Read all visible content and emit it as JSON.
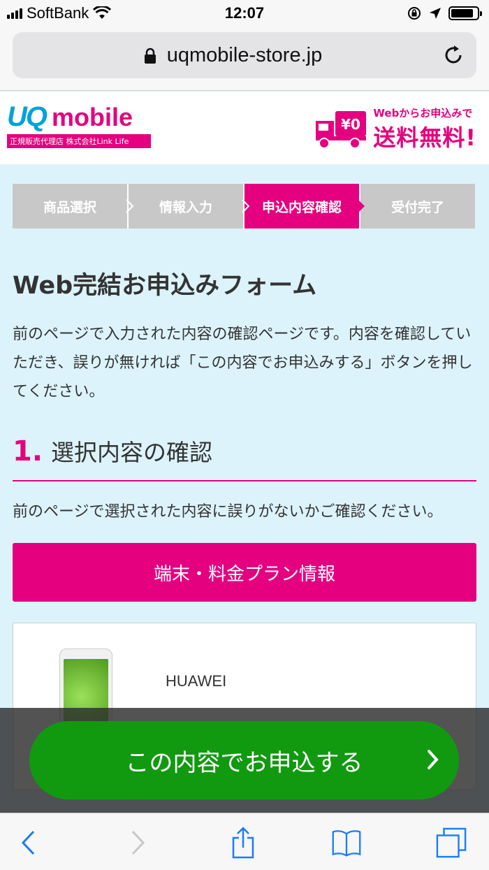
{
  "status_bar": {
    "carrier": "SoftBank",
    "time": "12:07",
    "battery_level": 0.85
  },
  "browser": {
    "url": "uqmobile-store.jp"
  },
  "header": {
    "logo_uq": "UQ",
    "logo_mobile": "mobile",
    "logo_sub": "正規販売代理店 株式会社Link Life",
    "promo_small": "Webからお申込みで",
    "promo_big": "送料無料!",
    "truck_label": "¥0"
  },
  "steps": [
    {
      "label": "商品選択",
      "active": false
    },
    {
      "label": "情報入力",
      "active": false
    },
    {
      "label": "申込内容確認",
      "active": true
    },
    {
      "label": "受付完了",
      "active": false
    }
  ],
  "main": {
    "title": "Web完結お申込みフォーム",
    "intro": "前のページで入力された内容の確認ページです。内容を確認していただき、誤りが無ければ「この内容でお申込みする」ボタンを押してください。",
    "section_number": "1.",
    "section_title": "選択内容の確認",
    "section_desc": "前のページで選択された内容に誤りがないかご確認ください。",
    "plan_header": "端末・料金プラン情報",
    "product_brand": "HUAWEI"
  },
  "cta": {
    "label": "この内容でお申込する"
  },
  "colors": {
    "brand_pink": "#e4007f",
    "brand_blue": "#00a2d9",
    "cta_green": "#119a10",
    "page_bg": "#ddf3fb",
    "ios_blue": "#1a7cf5"
  },
  "icons": {
    "lock": "lock-icon",
    "reload": "reload-icon",
    "truck": "truck-icon",
    "back": "back-chevron-icon",
    "forward": "forward-chevron-icon",
    "share": "share-icon",
    "bookmarks": "book-icon",
    "tabs": "tabs-icon"
  }
}
